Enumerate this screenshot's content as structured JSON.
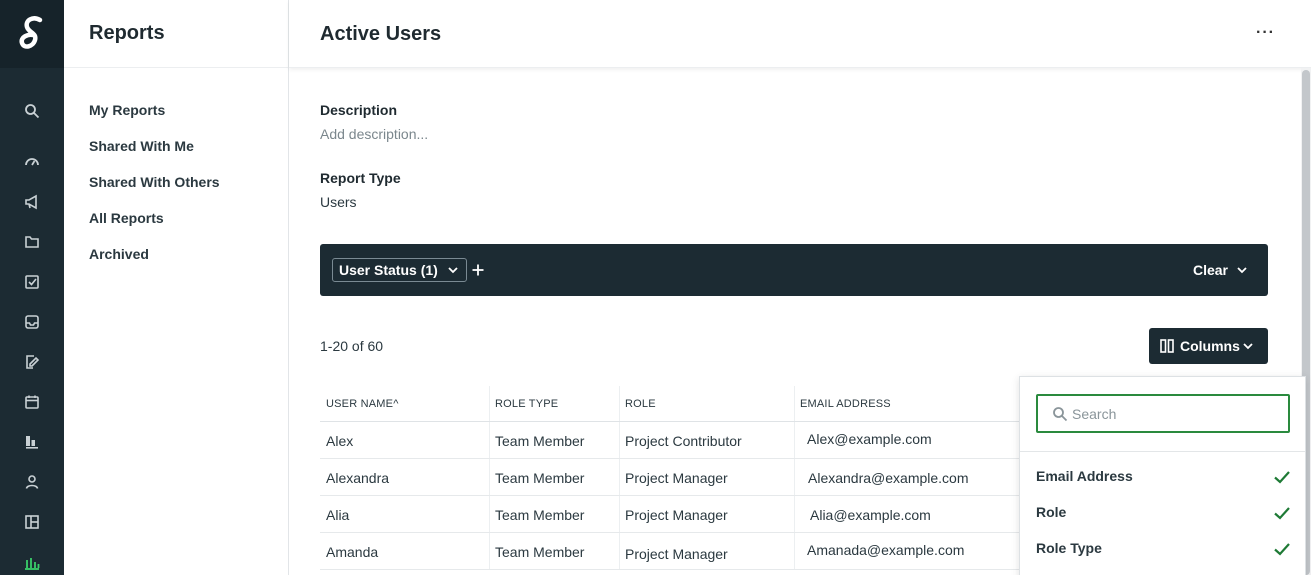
{
  "sidebar_nav": {
    "title": "Reports",
    "items": [
      "My Reports",
      "Shared With Me",
      "Shared With Others",
      "All Reports",
      "Archived"
    ]
  },
  "rail_icons": [
    "search-icon",
    "gauge-icon",
    "megaphone-icon",
    "folder-icon",
    "checkbox-icon",
    "inbox-icon",
    "edit-doc-icon",
    "calendar-icon",
    "board-icon",
    "user-icon",
    "layout-icon",
    "bar-chart-icon"
  ],
  "page": {
    "title": "Active Users",
    "more_label": "···"
  },
  "details": {
    "description_label": "Description",
    "description_placeholder": "Add description...",
    "report_type_label": "Report Type",
    "report_type_value": "Users"
  },
  "filter_bar": {
    "chip_label": "User Status (1)",
    "clear_label": "Clear"
  },
  "results": {
    "count_text": "1-20 of 60",
    "columns_button_label": "Columns"
  },
  "table": {
    "headers": [
      "USER NAME",
      "ROLE TYPE",
      "ROLE",
      "EMAIL ADDRESS"
    ],
    "sort_indicator": "^",
    "rows": [
      [
        "Alex",
        "Team Member",
        "Project Contributor",
        "Alex@example.com"
      ],
      [
        "Alexandra",
        "Team Member",
        "Project Manager",
        "Alexandra@example.com"
      ],
      [
        "Alia",
        "Team Member",
        "Project Manager",
        "Alia@example.com"
      ],
      [
        "Amanda",
        "Team Member",
        "Project Manager",
        "Amanada@example.com"
      ]
    ]
  },
  "columns_panel": {
    "search_placeholder": "Search",
    "options": [
      "Email Address",
      "Role",
      "Role Type"
    ]
  },
  "colors": {
    "rail_bg": "#1c2b33",
    "dark_bar": "#1c2b33",
    "accent_green": "#2a8a3e",
    "check_green": "#1e7a35"
  }
}
